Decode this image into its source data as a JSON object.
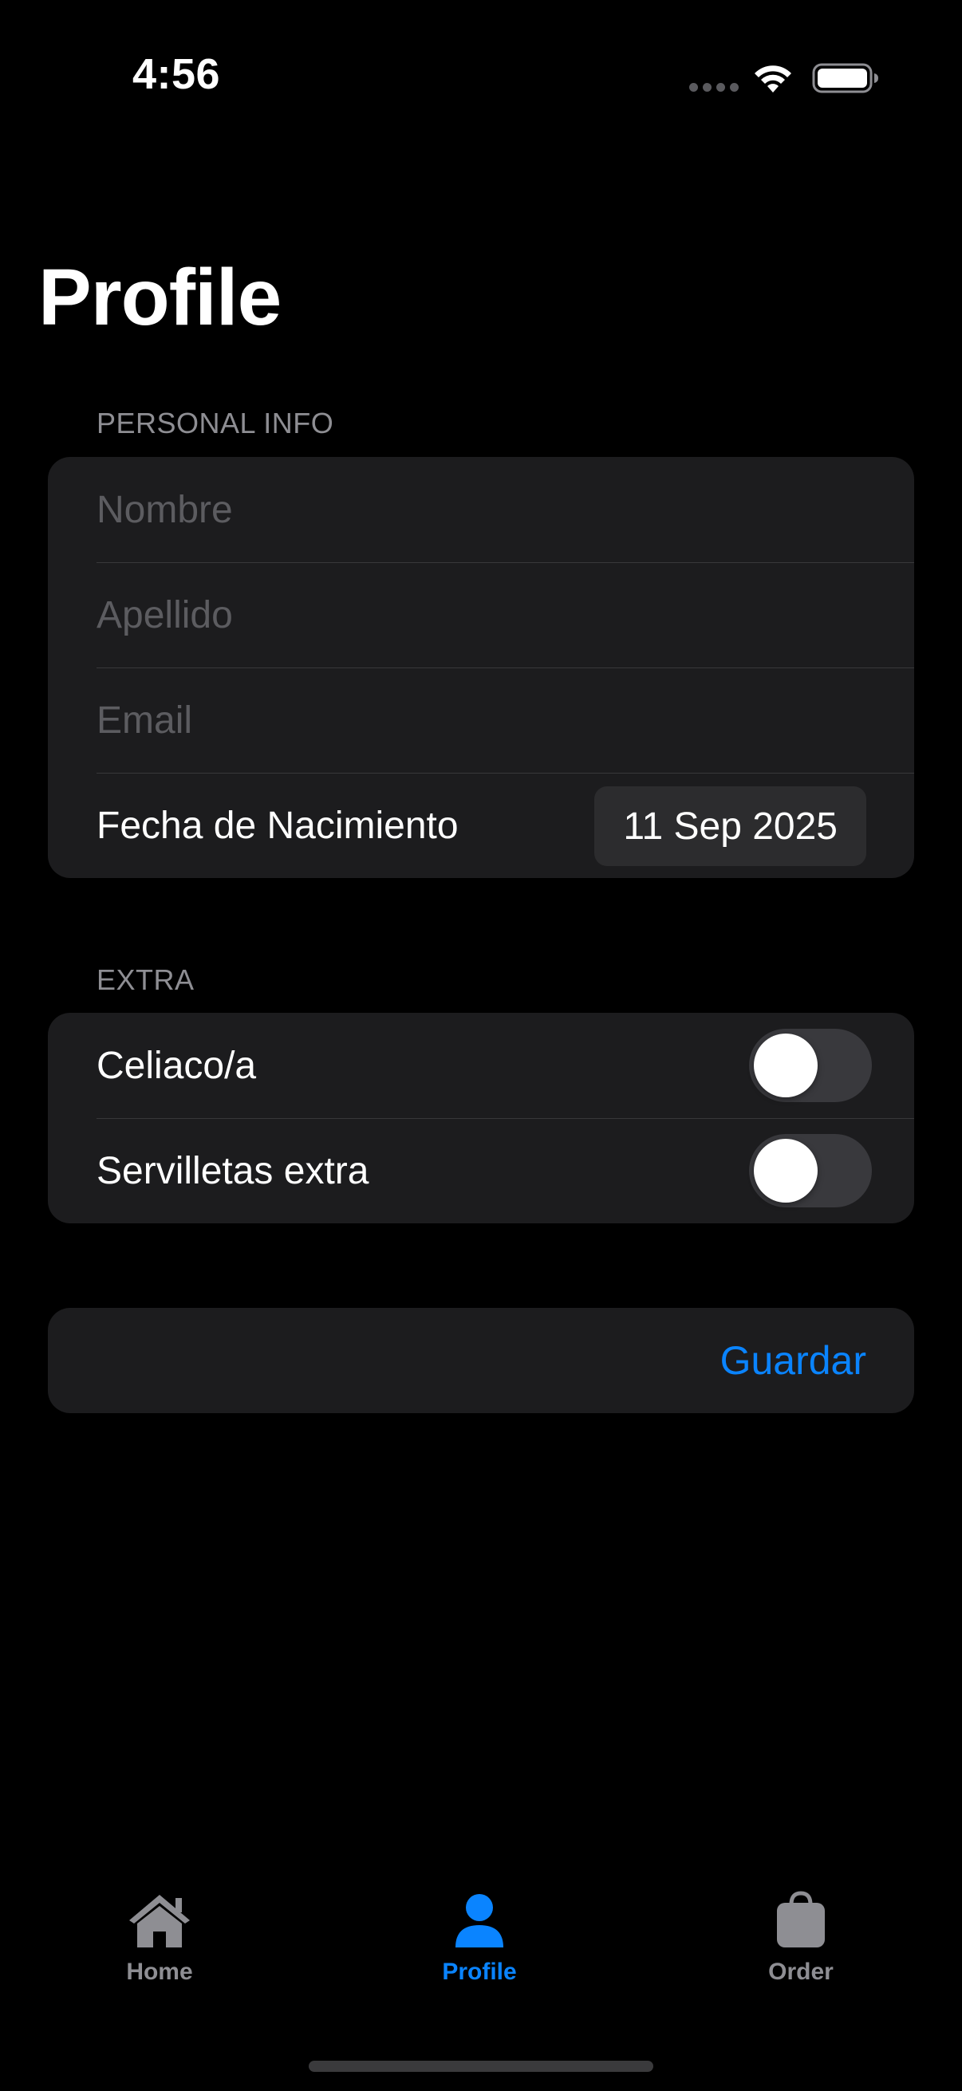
{
  "status_bar": {
    "time": "4:56"
  },
  "page": {
    "title": "Profile"
  },
  "personal_info": {
    "header": "PERSONAL INFO",
    "nombre_placeholder": "Nombre",
    "apellido_placeholder": "Apellido",
    "email_placeholder": "Email",
    "birthdate_label": "Fecha de Nacimiento",
    "birthdate_value": "11 Sep 2025"
  },
  "extra": {
    "header": "EXTRA",
    "items": [
      {
        "label": "Celiaco/a",
        "on": false
      },
      {
        "label": "Servilletas extra",
        "on": false
      }
    ]
  },
  "actions": {
    "save_label": "Guardar"
  },
  "tab_bar": {
    "items": [
      {
        "label": "Home",
        "icon": "house-icon",
        "selected": false
      },
      {
        "label": "Profile",
        "icon": "person-icon",
        "selected": true
      },
      {
        "label": "Order",
        "icon": "bag-icon",
        "selected": false
      }
    ]
  },
  "colors": {
    "background": "#000000",
    "card": "#1c1c1e",
    "accent": "#0a84ff",
    "secondary_text": "#8e8e93",
    "inactive_tab": "#8e8e93"
  }
}
